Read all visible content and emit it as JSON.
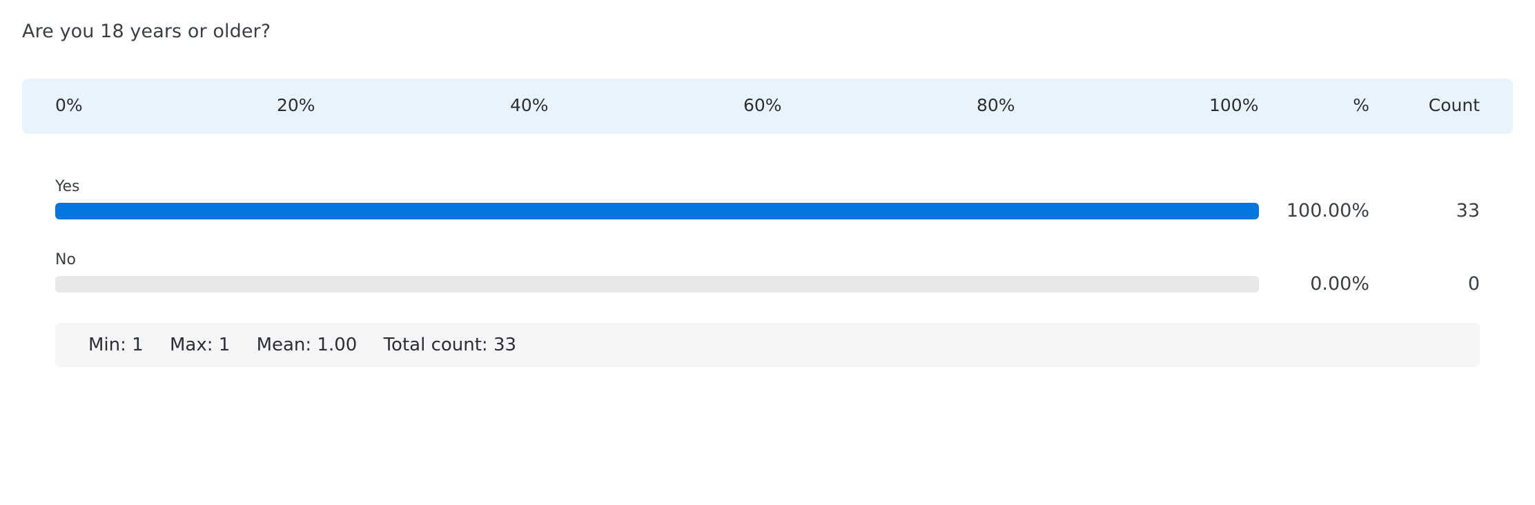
{
  "question": "Are you 18 years or older?",
  "header": {
    "ticks": [
      "0%",
      "20%",
      "40%",
      "60%",
      "80%",
      "100%"
    ],
    "pct_label": "%",
    "count_label": "Count"
  },
  "colors": {
    "bar_fill": "#0575e0",
    "bar_track": "#e8e8e9",
    "header_bg": "#e9f3fc",
    "stats_bg": "#f4f5f7"
  },
  "chart_data": {
    "type": "bar",
    "orientation": "horizontal",
    "title": "Are you 18 years or older?",
    "categories": [
      "Yes",
      "No"
    ],
    "values": [
      100.0,
      0.0
    ],
    "percent_labels": [
      "100.00%",
      "0.00%"
    ],
    "counts": [
      33,
      0
    ],
    "count_labels": [
      "33",
      "0"
    ],
    "xlim": [
      0,
      100
    ],
    "xticks": [
      "0%",
      "20%",
      "40%",
      "60%",
      "80%",
      "100%"
    ]
  },
  "stats": {
    "min": "Min: 1",
    "max": "Max: 1",
    "mean": "Mean: 1.00",
    "total": "Total count: 33"
  }
}
